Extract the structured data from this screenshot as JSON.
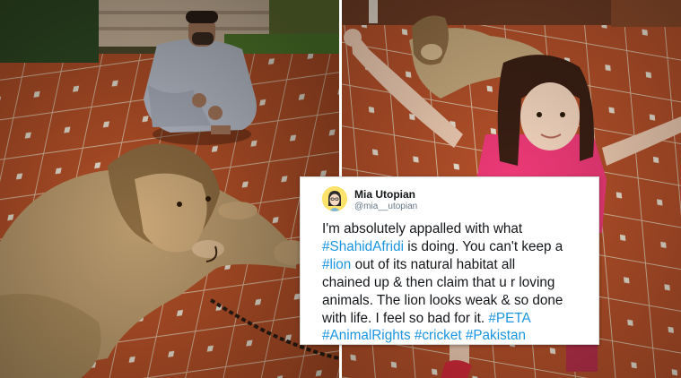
{
  "tweet": {
    "name": "Mia Utopian",
    "handle": "@mia__utopian",
    "lines": [
      [
        {
          "t": "I'm absolutely appalled with what",
          "tag": false
        }
      ],
      [
        {
          "t": "#ShahidAfridi",
          "tag": true
        },
        {
          "t": " is doing. You can't keep a",
          "tag": false
        }
      ],
      [
        {
          "t": "#lion",
          "tag": true
        },
        {
          "t": " out of its natural habitat all",
          "tag": false
        }
      ],
      [
        {
          "t": "chained up & then claim that u r loving",
          "tag": false
        }
      ],
      [
        {
          "t": "animals. The lion looks weak & so done",
          "tag": false
        }
      ],
      [
        {
          "t": "with life. I feel so bad for it. ",
          "tag": false
        },
        {
          "t": "#PETA",
          "tag": true
        }
      ],
      [
        {
          "t": "#AnimalRights",
          "tag": true
        },
        {
          "t": " ",
          "tag": false
        },
        {
          "t": "#cricket",
          "tag": true
        },
        {
          "t": " ",
          "tag": false
        },
        {
          "t": "#Pakistan",
          "tag": true
        }
      ]
    ]
  },
  "colors": {
    "hashtag": "#1b95e0",
    "text": "#14171a",
    "handle": "#657786",
    "floor_tile": "#b4522a",
    "girl_top": "#ef3a78"
  }
}
